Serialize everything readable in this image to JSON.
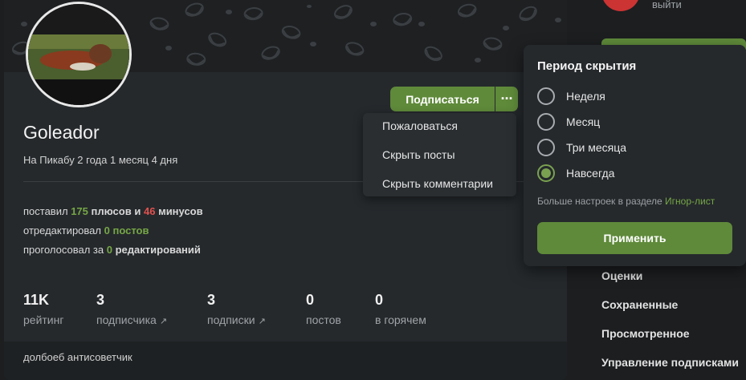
{
  "profile": {
    "username": "Goleador",
    "on_site": "На Пикабу 2 года 1 месяц 4 дня",
    "subscribe_label": "Подписаться",
    "more_label": "···",
    "stats": {
      "gave_prefix": "поставил",
      "pluses_count": "175",
      "pluses_word": "плюсов",
      "and_word": "и",
      "minuses_count": "46",
      "minuses_word": "минусов",
      "edited_prefix": "отредактировал",
      "edited_count": "0",
      "edited_word": "постов",
      "voted_prefix": "проголосовал за",
      "voted_count": "0",
      "voted_word": "редактирований"
    },
    "counters": [
      {
        "value": "11K",
        "label": "рейтинг",
        "external": false
      },
      {
        "value": "3",
        "label": "подписчика",
        "external": true
      },
      {
        "value": "3",
        "label": "подписки",
        "external": true
      },
      {
        "value": "0",
        "label": "постов",
        "external": false
      },
      {
        "value": "0",
        "label": "в горячем",
        "external": false
      }
    ],
    "bio": "долбоеб антисоветчик"
  },
  "dropdown": {
    "items": [
      "Пожаловаться",
      "Скрыть посты",
      "Скрыть комментарии"
    ]
  },
  "hide_popup": {
    "title": "Период скрытия",
    "options": [
      {
        "label": "Неделя",
        "checked": false
      },
      {
        "label": "Месяц",
        "checked": false
      },
      {
        "label": "Три месяца",
        "checked": false
      },
      {
        "label": "Навсегда",
        "checked": true
      }
    ],
    "note_prefix": "Больше настроек в разделе",
    "note_link": "Игнор-лист",
    "apply_label": "Применить"
  },
  "sidebar": {
    "logout_label": "выйти",
    "links": [
      "Оценки",
      "Сохраненные",
      "Просмотренное",
      "Управление подписками"
    ]
  },
  "colors": {
    "accent_green": "#5f8a3a",
    "positive": "#76a646",
    "negative": "#e0524f",
    "background": "#1c1e20",
    "card": "#25292c"
  },
  "icons": {
    "external": "external-link-icon",
    "more": "more-dots-icon"
  }
}
